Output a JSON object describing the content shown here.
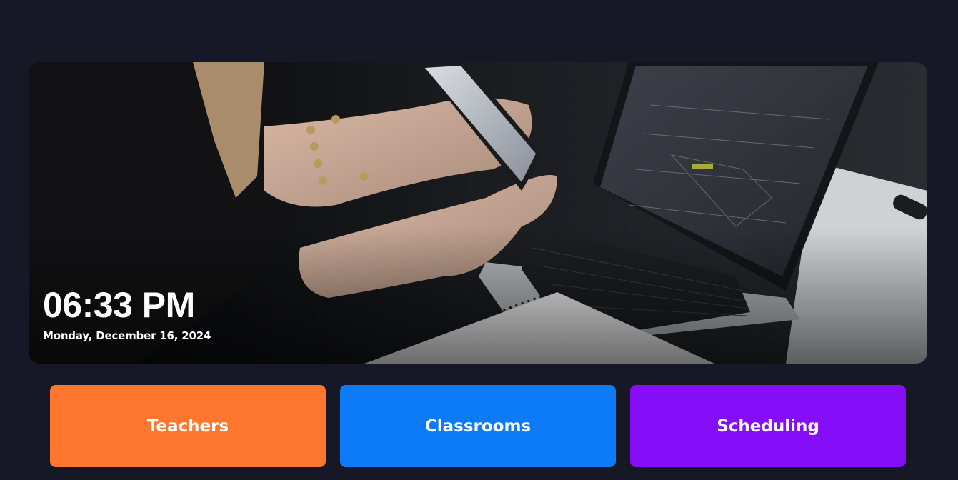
{
  "hero": {
    "time": "06:33 PM",
    "date": "Monday, December 16, 2024",
    "image": "photo of a person holding a smartphone beside a laptop and spiral notebook"
  },
  "tiles": [
    {
      "label": "Teachers",
      "color": "#ff772e"
    },
    {
      "label": "Classrooms",
      "color": "#0d7bf7"
    },
    {
      "label": "Scheduling",
      "color": "#860df7"
    }
  ],
  "colors": {
    "background": "#161826",
    "text": "#ffffff"
  }
}
